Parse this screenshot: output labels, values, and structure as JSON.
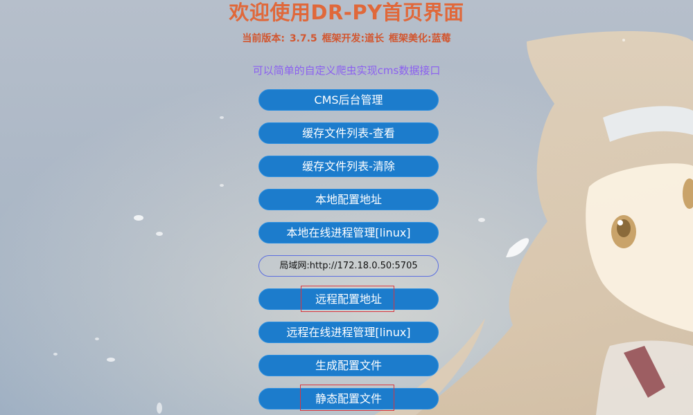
{
  "header": {
    "title": "欢迎使用DR-PY首页界面",
    "version_label": "当前版本:",
    "version_value": "3.7.5",
    "framework_dev": "框架开发:道长",
    "framework_beauty": "框架美化:蓝莓"
  },
  "subtitle": "可以简单的自定义爬虫实现cms数据接口",
  "buttons": [
    {
      "label": "CMS后台管理"
    },
    {
      "label": "缓存文件列表-查看"
    },
    {
      "label": "缓存文件列表-清除"
    },
    {
      "label": "本地配置地址"
    },
    {
      "label": "本地在线进程管理[linux]"
    },
    {
      "label": "局域网:http://172.18.0.50:5705"
    },
    {
      "label": "远程配置地址"
    },
    {
      "label": "远程在线进程管理[linux]"
    },
    {
      "label": "生成配置文件"
    },
    {
      "label": "静态配置文件"
    }
  ],
  "colors": {
    "title": "#e0683a",
    "version": "#d2562f",
    "subtitle": "#8b5ff0",
    "button_bg": "#1c7ccc",
    "outline_border": "#5a6de0",
    "highlight": "#d9363e"
  }
}
